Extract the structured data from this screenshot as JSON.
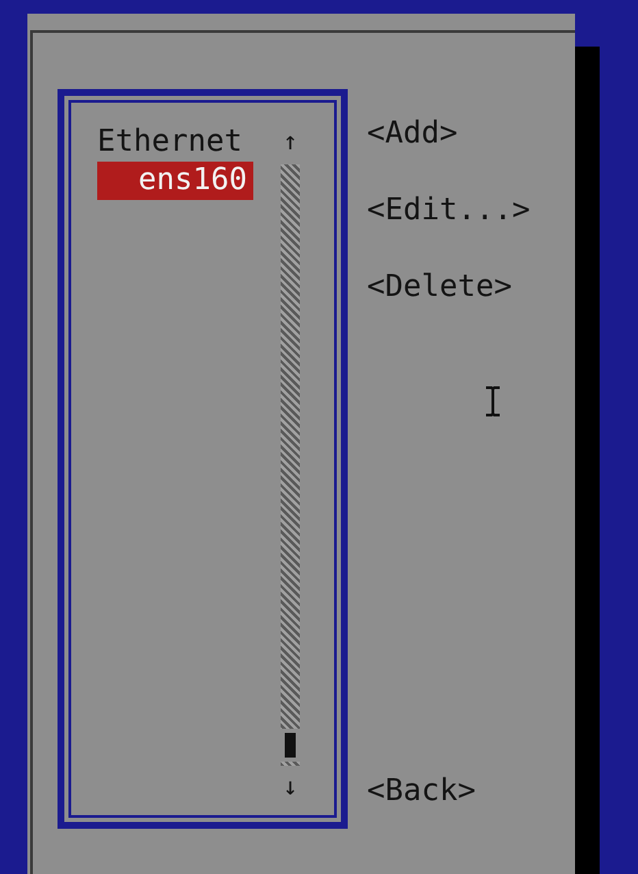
{
  "connection_list": {
    "items": [
      {
        "kind": "header",
        "label": "Ethernet",
        "selected": false
      },
      {
        "kind": "connection",
        "label": "ens160",
        "selected": true
      }
    ],
    "scrollbar": {
      "up": "↑",
      "down": "↓"
    }
  },
  "buttons": [
    {
      "label": "<Add>"
    },
    {
      "label": "<Edit...>"
    },
    {
      "label": "<Delete>"
    },
    {
      "label": "<Back>"
    }
  ]
}
